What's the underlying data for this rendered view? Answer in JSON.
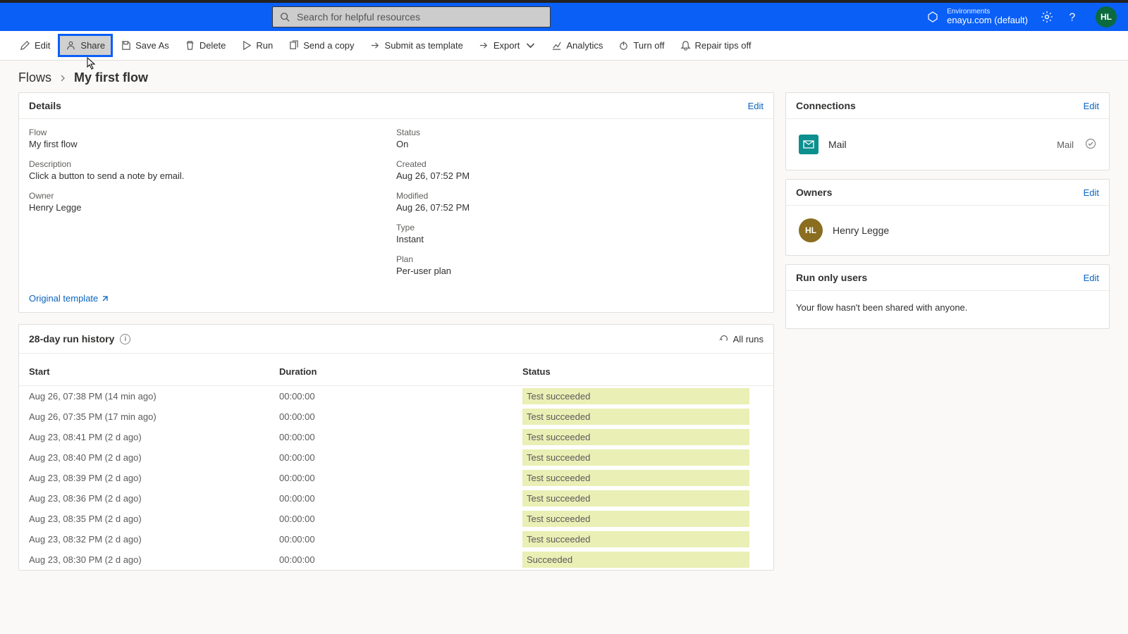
{
  "header": {
    "search_placeholder": "Search for helpful resources",
    "env_label": "Environments",
    "env_name": "enayu.com (default)",
    "avatar_initials": "HL"
  },
  "commands": {
    "edit": "Edit",
    "share": "Share",
    "save_as": "Save As",
    "delete": "Delete",
    "run": "Run",
    "send_copy": "Send a copy",
    "submit_template": "Submit as template",
    "export": "Export",
    "analytics": "Analytics",
    "turn_off": "Turn off",
    "repair_tips": "Repair tips off"
  },
  "breadcrumb": {
    "root": "Flows",
    "current": "My first flow"
  },
  "details": {
    "title": "Details",
    "edit": "Edit",
    "labels": {
      "flow": "Flow",
      "description": "Description",
      "owner": "Owner",
      "status": "Status",
      "created": "Created",
      "modified": "Modified",
      "type": "Type",
      "plan": "Plan"
    },
    "values": {
      "flow": "My first flow",
      "description": "Click a button to send a note by email.",
      "owner": "Henry Legge",
      "status": "On",
      "created": "Aug 26, 07:52 PM",
      "modified": "Aug 26, 07:52 PM",
      "type": "Instant",
      "plan": "Per-user plan"
    },
    "original_template": "Original template"
  },
  "connections": {
    "title": "Connections",
    "edit": "Edit",
    "items": [
      {
        "name": "Mail",
        "type": "Mail"
      }
    ]
  },
  "owners": {
    "title": "Owners",
    "edit": "Edit",
    "items": [
      {
        "initials": "HL",
        "name": "Henry Legge"
      }
    ]
  },
  "run_only": {
    "title": "Run only users",
    "edit": "Edit",
    "message": "Your flow hasn't been shared with anyone."
  },
  "runs": {
    "title": "28-day run history",
    "all_runs": "All runs",
    "cols": {
      "start": "Start",
      "duration": "Duration",
      "status": "Status"
    },
    "rows": [
      {
        "start": "Aug 26, 07:38 PM (14 min ago)",
        "duration": "00:00:00",
        "status": "Test succeeded"
      },
      {
        "start": "Aug 26, 07:35 PM (17 min ago)",
        "duration": "00:00:00",
        "status": "Test succeeded"
      },
      {
        "start": "Aug 23, 08:41 PM (2 d ago)",
        "duration": "00:00:00",
        "status": "Test succeeded"
      },
      {
        "start": "Aug 23, 08:40 PM (2 d ago)",
        "duration": "00:00:00",
        "status": "Test succeeded"
      },
      {
        "start": "Aug 23, 08:39 PM (2 d ago)",
        "duration": "00:00:00",
        "status": "Test succeeded"
      },
      {
        "start": "Aug 23, 08:36 PM (2 d ago)",
        "duration": "00:00:00",
        "status": "Test succeeded"
      },
      {
        "start": "Aug 23, 08:35 PM (2 d ago)",
        "duration": "00:00:00",
        "status": "Test succeeded"
      },
      {
        "start": "Aug 23, 08:32 PM (2 d ago)",
        "duration": "00:00:00",
        "status": "Test succeeded"
      },
      {
        "start": "Aug 23, 08:30 PM (2 d ago)",
        "duration": "00:00:00",
        "status": "Succeeded"
      }
    ]
  }
}
